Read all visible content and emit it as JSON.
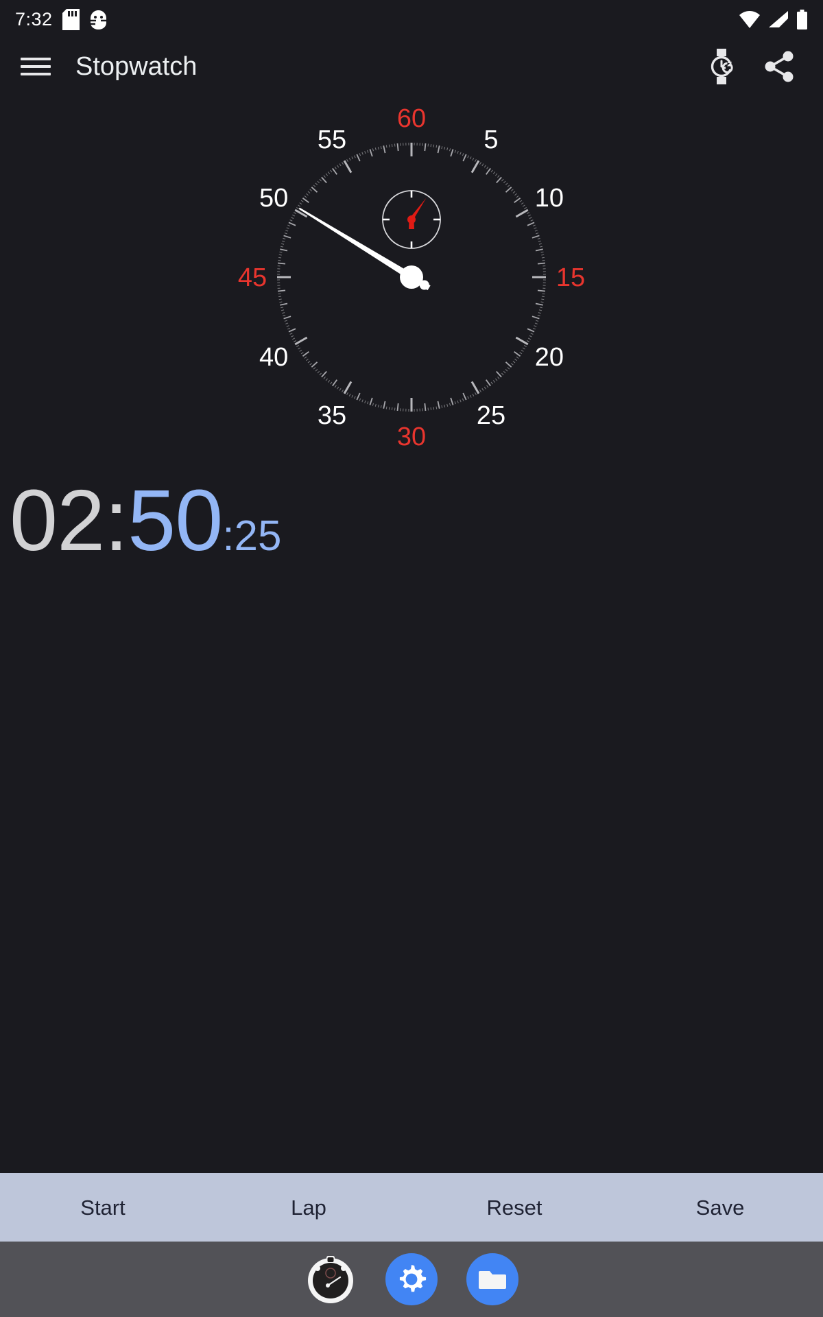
{
  "status_bar": {
    "time": "7:32",
    "left_icons": [
      "sd-card-icon",
      "android-debug-icon"
    ],
    "right_icons": [
      "wifi-icon",
      "cellular-signal-icon",
      "battery-icon"
    ]
  },
  "toolbar": {
    "menu_icon": "hamburger-menu-icon",
    "title": "Stopwatch",
    "actions": [
      {
        "name": "wearable-sync-icon",
        "label": "Wear"
      },
      {
        "name": "share-icon",
        "label": "Share"
      }
    ]
  },
  "dial": {
    "labels": [
      {
        "text": "60",
        "seconds": 60,
        "color": "#e8352e"
      },
      {
        "text": "5",
        "seconds": 5,
        "color": "#ffffff"
      },
      {
        "text": "10",
        "seconds": 10,
        "color": "#ffffff"
      },
      {
        "text": "15",
        "seconds": 15,
        "color": "#e8352e"
      },
      {
        "text": "20",
        "seconds": 20,
        "color": "#ffffff"
      },
      {
        "text": "25",
        "seconds": 25,
        "color": "#ffffff"
      },
      {
        "text": "30",
        "seconds": 30,
        "color": "#e8352e"
      },
      {
        "text": "35",
        "seconds": 35,
        "color": "#ffffff"
      },
      {
        "text": "40",
        "seconds": 40,
        "color": "#ffffff"
      },
      {
        "text": "45",
        "seconds": 45,
        "color": "#e8352e"
      },
      {
        "text": "50",
        "seconds": 50,
        "color": "#ffffff"
      },
      {
        "text": "55",
        "seconds": 55,
        "color": "#ffffff"
      }
    ],
    "second_hand_seconds": 50.25,
    "minute_subdial_minutes": 2.85,
    "tick_color": "#b8b8bc",
    "hand_color": "#ffffff",
    "subdial_hand_color": "#e01b14"
  },
  "time_display": {
    "minutes": "02:",
    "seconds": "50",
    "fraction": ":25",
    "main_color": "#d2d2d4",
    "accent_color": "#93b6f5"
  },
  "action_bar": {
    "background": "#bec6da",
    "text_color": "#1f2233",
    "buttons": [
      {
        "label": "Start"
      },
      {
        "label": "Lap"
      },
      {
        "label": "Reset"
      },
      {
        "label": "Save"
      }
    ]
  },
  "nav_bar": {
    "background": "#525257",
    "accent": "#4285f4",
    "items": [
      {
        "name": "stopwatch-nav-icon",
        "label": "Stopwatch"
      },
      {
        "name": "settings-gear-nav-icon",
        "label": "Settings"
      },
      {
        "name": "folder-nav-icon",
        "label": "Files"
      }
    ]
  }
}
